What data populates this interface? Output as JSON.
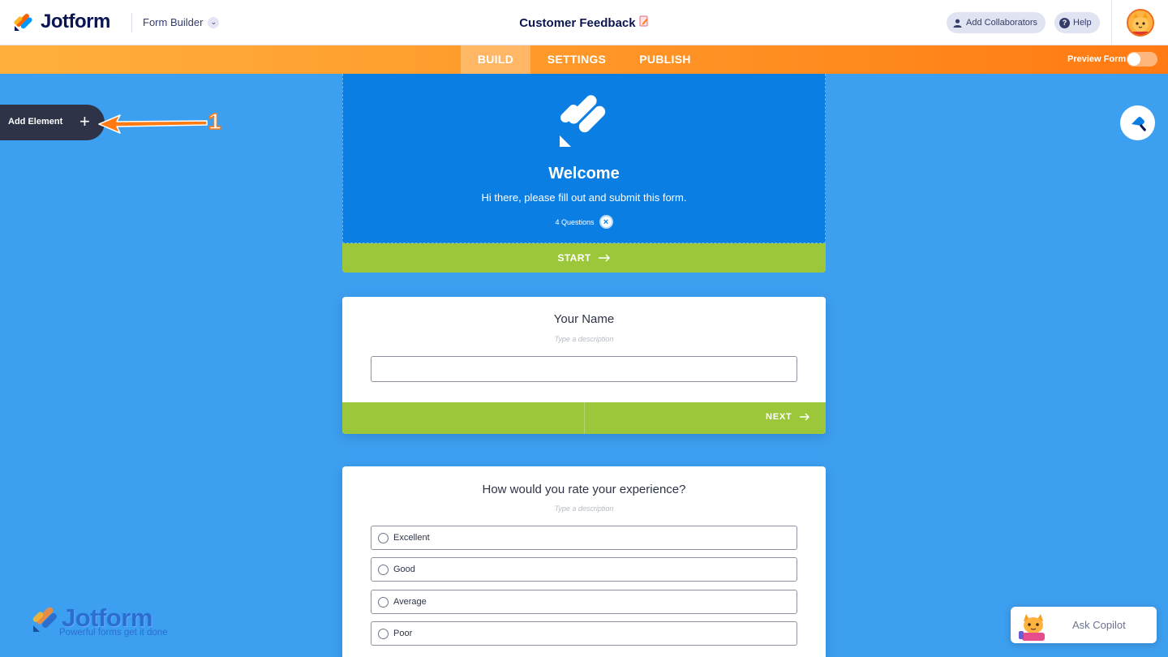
{
  "header": {
    "brand": "Jotform",
    "builder_menu": "Form Builder",
    "form_title": "Customer Feedback",
    "add_collaborators": "Add Collaborators",
    "help": "Help"
  },
  "nav": {
    "tabs": [
      {
        "label": "BUILD",
        "active": true
      },
      {
        "label": "SETTINGS",
        "active": false
      },
      {
        "label": "PUBLISH",
        "active": false
      }
    ],
    "preview_label": "Preview Form",
    "preview_enabled": false
  },
  "sidebar": {
    "add_element_label": "Add Element",
    "add_element_icon": "plus-icon"
  },
  "annotation": {
    "number": "1"
  },
  "welcome": {
    "title": "Welcome",
    "subtitle": "Hi there, please fill out and submit this form.",
    "question_count": "4 Questions",
    "start_label": "START"
  },
  "questions": [
    {
      "title": "Your Name",
      "description_placeholder": "Type a description",
      "type": "text",
      "value": "",
      "next_label": "NEXT"
    },
    {
      "title": "How would you rate your experience?",
      "description_placeholder": "Type a description",
      "type": "radio",
      "options": [
        "Excellent",
        "Good",
        "Average",
        "Poor"
      ]
    }
  ],
  "watermark": {
    "brand": "Jotform",
    "tagline": "Powerful forms get it done"
  },
  "copilot": {
    "label": "Ask Copilot"
  },
  "colors": {
    "canvas_bg": "#3d9ff0",
    "welcome_bg": "#0a7ee3",
    "accent_green": "#9dc73b",
    "nav_orange": "#ff7a12",
    "dark": "#0a1551"
  }
}
